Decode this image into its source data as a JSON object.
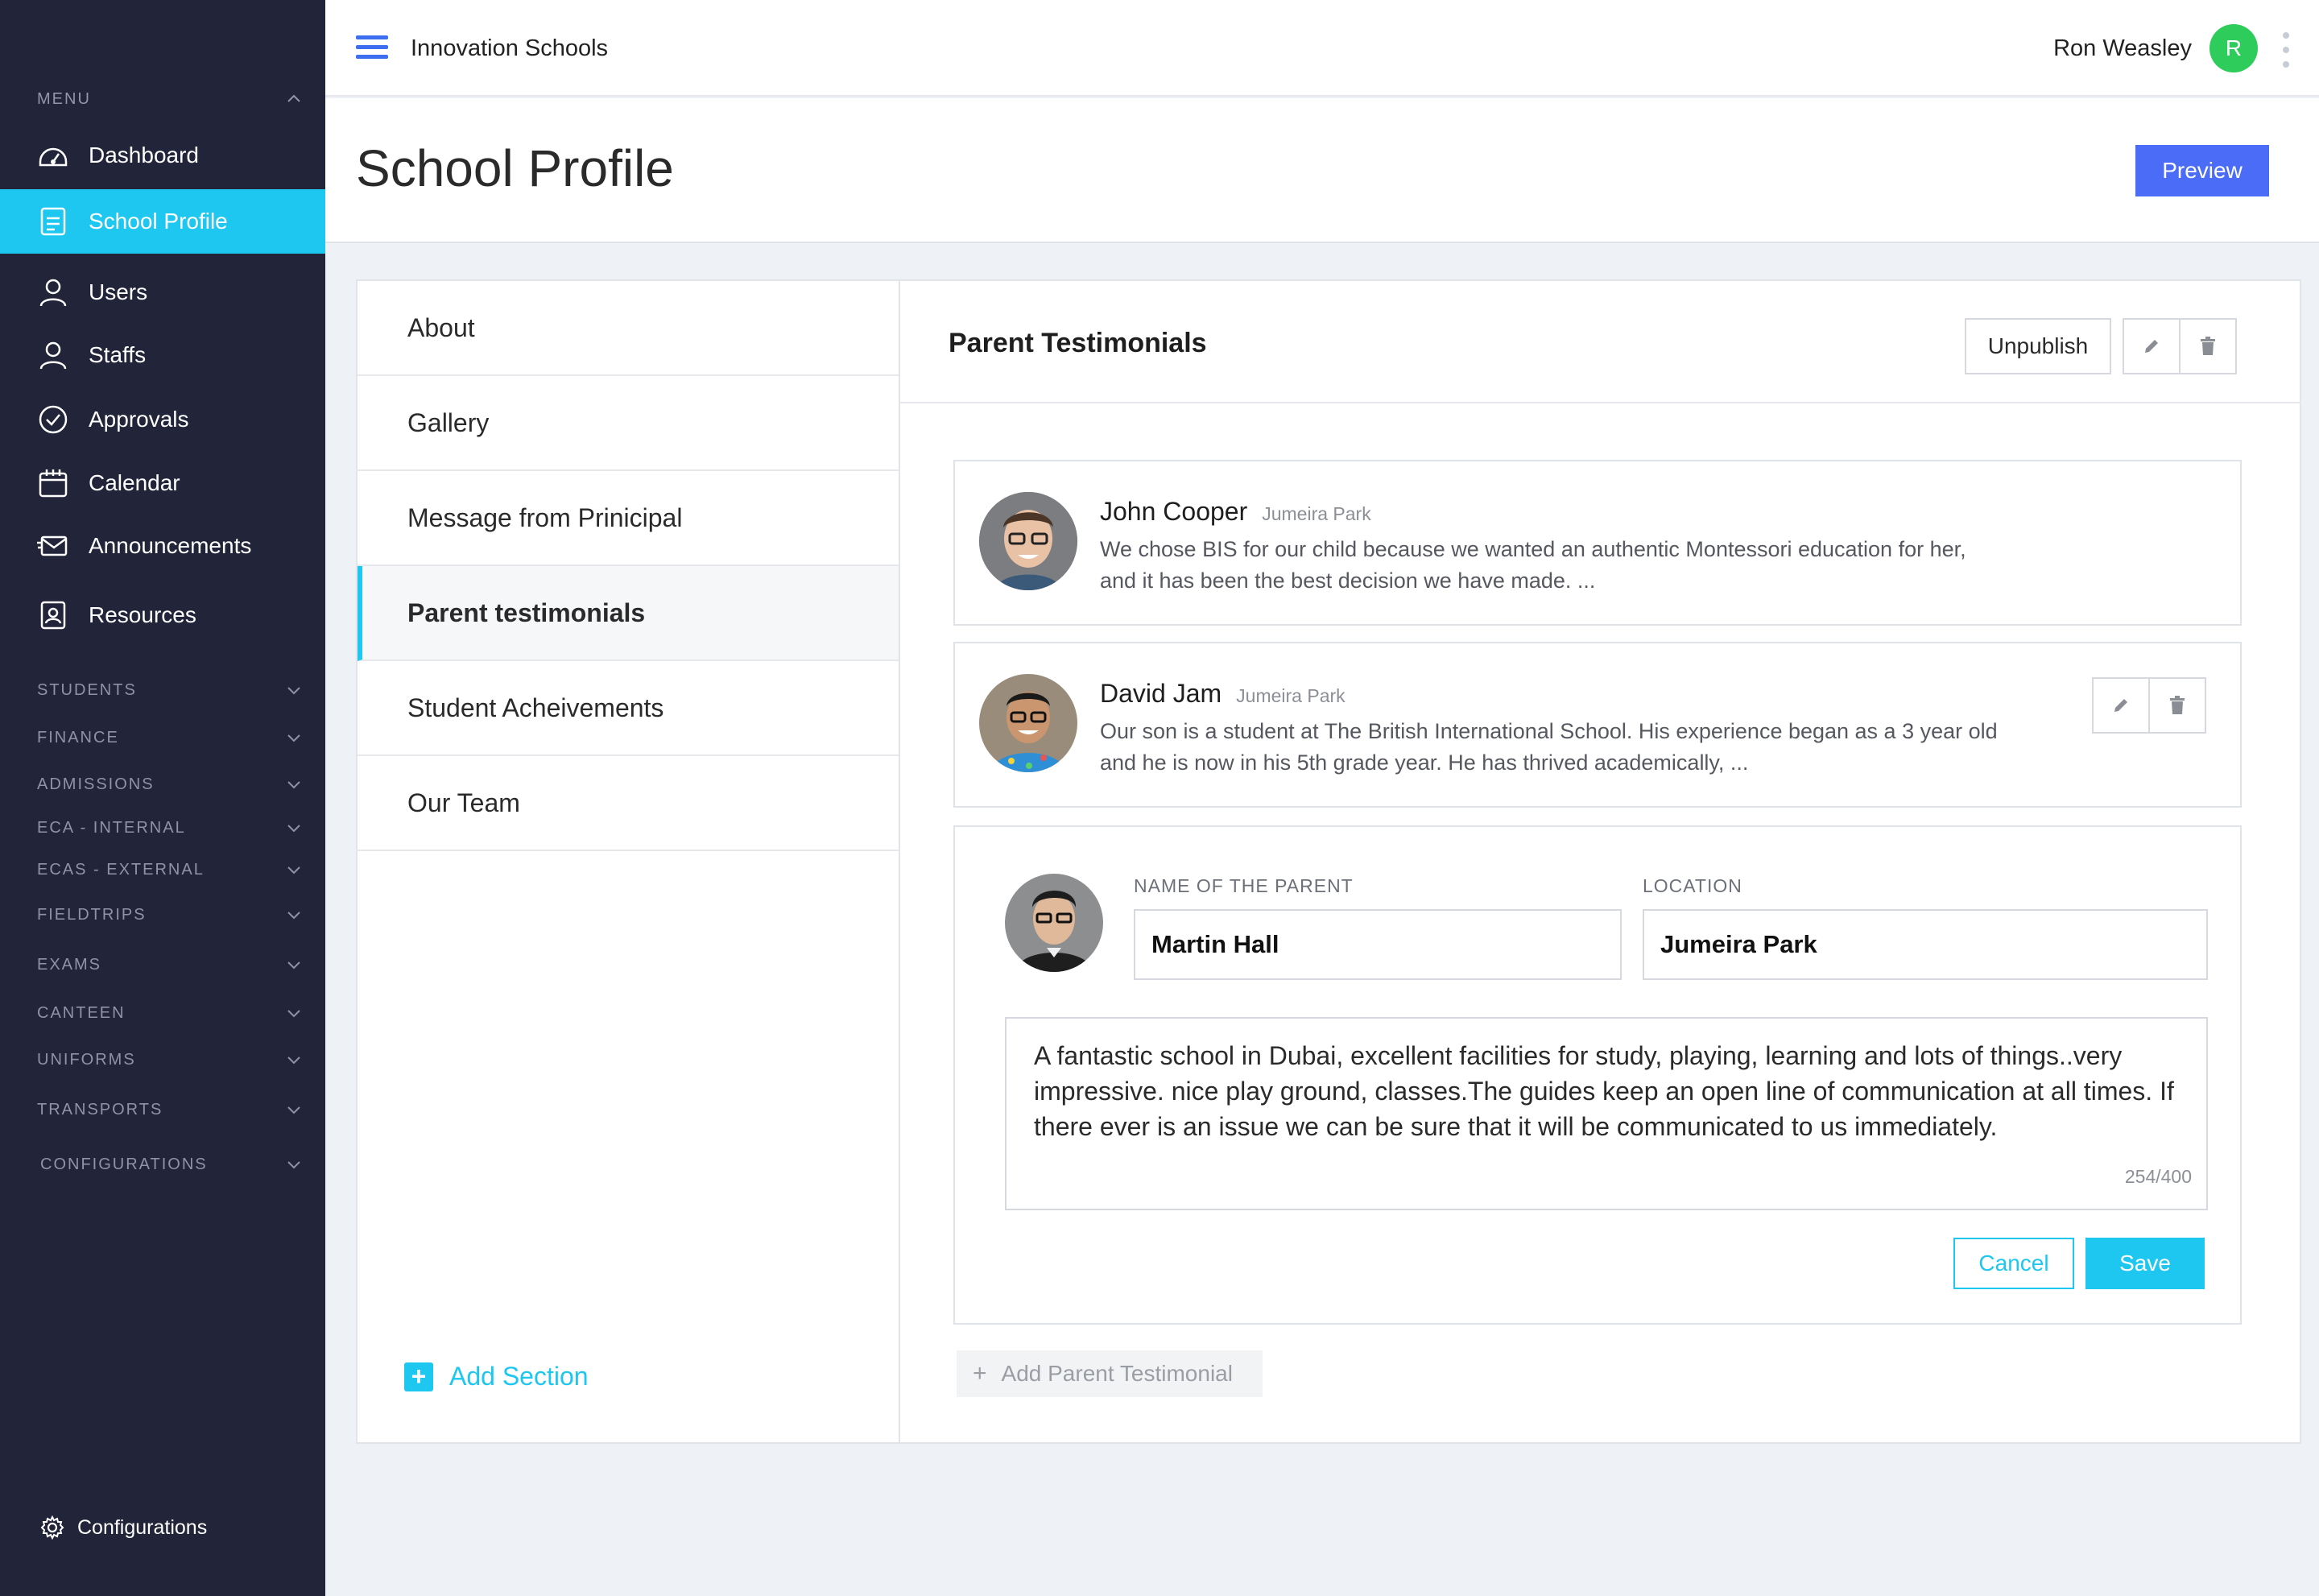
{
  "header": {
    "app_title": "Innovation Schools",
    "user_name": "Ron Weasley",
    "user_initial": "R"
  },
  "sidebar": {
    "menu_label": "MENU",
    "items": [
      {
        "label": "Dashboard",
        "icon": "dashboard-icon"
      },
      {
        "label": "School Profile",
        "icon": "profile-icon",
        "active": true
      },
      {
        "label": "Users",
        "icon": "user-icon"
      },
      {
        "label": "Staffs",
        "icon": "user-icon"
      },
      {
        "label": "Approvals",
        "icon": "check-circle-icon"
      },
      {
        "label": "Calendar",
        "icon": "calendar-icon"
      },
      {
        "label": "Announcements",
        "icon": "mail-icon"
      },
      {
        "label": "Resources",
        "icon": "resources-icon"
      }
    ],
    "sections": [
      "STUDENTS",
      "FINANCE",
      "ADMISSIONS",
      "ECA - INTERNAL",
      "ECAS - EXTERNAL",
      "FIELDTRIPS",
      "EXAMS",
      "CANTEEN",
      "UNIFORMS",
      "TRANSPORTS",
      "CONFIGURATIONS"
    ],
    "footer_label": "Configurations",
    "accent_color": "#1ec7f0"
  },
  "page": {
    "title": "School Profile",
    "preview_label": "Preview"
  },
  "profile_sections": {
    "items": [
      "About",
      "Gallery",
      "Message from Prinicipal",
      "Parent testimonials",
      "Student Acheivements",
      "Our Team"
    ],
    "active": "Parent testimonials",
    "add_label": "Add Section"
  },
  "panel": {
    "title": "Parent Testimonials",
    "unpublish_label": "Unpublish",
    "testimonials": [
      {
        "name": "John Cooper",
        "location": "Jumeira Park",
        "quote": "We chose BIS for our child because we wanted an authentic Montessori education for her, and it has been the best decision we have made. ..."
      },
      {
        "name": "David Jam",
        "location": "Jumeira Park",
        "quote": "Our son is a student at The British International School. His experience began as a 3 year old and he is now in his 5th grade year. He has thrived academically, ..."
      }
    ],
    "edit_form": {
      "name_label": "NAME OF THE PARENT",
      "name_value": "Martin Hall",
      "location_label": "LOCATION",
      "location_value": "Jumeira Park",
      "text": "A fantastic school in Dubai, excellent facilities for study, playing, learning and lots of things..very impressive. nice play ground, classes.The guides keep an open line of communication at all times. If there ever is an issue we can be sure that it will be communicated to us immediately.",
      "counter": "254/400",
      "cancel_label": "Cancel",
      "save_label": "Save"
    },
    "add_label": "Add Parent Testimonial"
  }
}
